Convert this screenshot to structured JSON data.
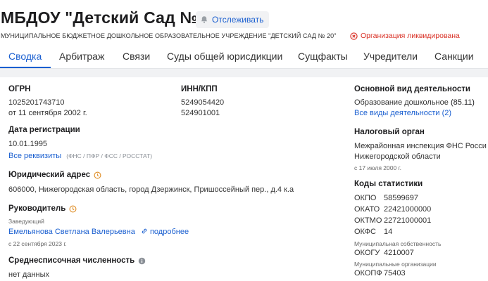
{
  "header": {
    "title": "МБДОУ \"Детский Сад № 20\"",
    "follow_label": "Отслеживать",
    "full_name": "МУНИЦИПАЛЬНОЕ БЮДЖЕТНОЕ ДОШКОЛЬНОЕ ОБРАЗОВАТЕЛЬНОЕ УЧРЕЖДЕНИЕ \"ДЕТСКИЙ САД № 20\"",
    "status": "Организация ликвидирована"
  },
  "tabs": [
    "Сводка",
    "Арбитраж",
    "Связи",
    "Суды общей юрисдикции",
    "Сущфакты",
    "Учредители",
    "Санкции"
  ],
  "ogrn": {
    "label": "ОГРН",
    "value": "1025201743710",
    "date": "от 11 сентября 2002 г."
  },
  "inn": {
    "label": "ИНН/КПП",
    "inn": "5249054420",
    "kpp": "524901001"
  },
  "registration": {
    "label": "Дата регистрации",
    "value": "10.01.1995",
    "details_link": "Все реквизиты",
    "details_note": "(ФНС / ПФР / ФСС / РОССТАТ)"
  },
  "address": {
    "label": "Юридический адрес",
    "value": "606000, Нижегородская область, город Дзержинск, Пришоссейный пер., д.4 к.а"
  },
  "head": {
    "label": "Руководитель",
    "position": "Заведующий",
    "name": "Емельянова Светлана Валерьевна",
    "more_link": "подробнее",
    "since": "с 22 сентября 2023 г."
  },
  "headcount": {
    "label": "Среднесписочная численность",
    "value": "нет данных"
  },
  "activity": {
    "label": "Основной вид деятельности",
    "value": "Образование дошкольное",
    "code": "(85.11)",
    "all_link": "Все виды деятельности (2)"
  },
  "tax": {
    "label": "Налоговый орган",
    "line1": "Межрайонная инспекция ФНС Росси",
    "line2": "Нижегородской области",
    "since": "с 17 июля 2000 г."
  },
  "stats": {
    "label": "Коды статистики",
    "okpo_k": "ОКПО",
    "okpo_v": "58599697",
    "okato_k": "ОКАТО",
    "okato_v": "22421000000",
    "oktmo_k": "ОКТМО",
    "oktmo_v": "22721000001",
    "okfs_k": "ОКФС",
    "okfs_v": "14",
    "okfs_note": "Муниципальная собственность",
    "okogu_k": "ОКОГУ",
    "okogu_v": "4210007",
    "okogu_note": "Муниципальные организации",
    "okopf_k": "ОКОПФ",
    "okopf_v": "75403"
  },
  "colors": {
    "accent": "#1a5fd0",
    "danger": "#d93025",
    "clock": "#e0922f"
  },
  "icons": [
    "bell-icon",
    "close-circle-icon",
    "clock-icon",
    "link-icon",
    "info-icon"
  ]
}
